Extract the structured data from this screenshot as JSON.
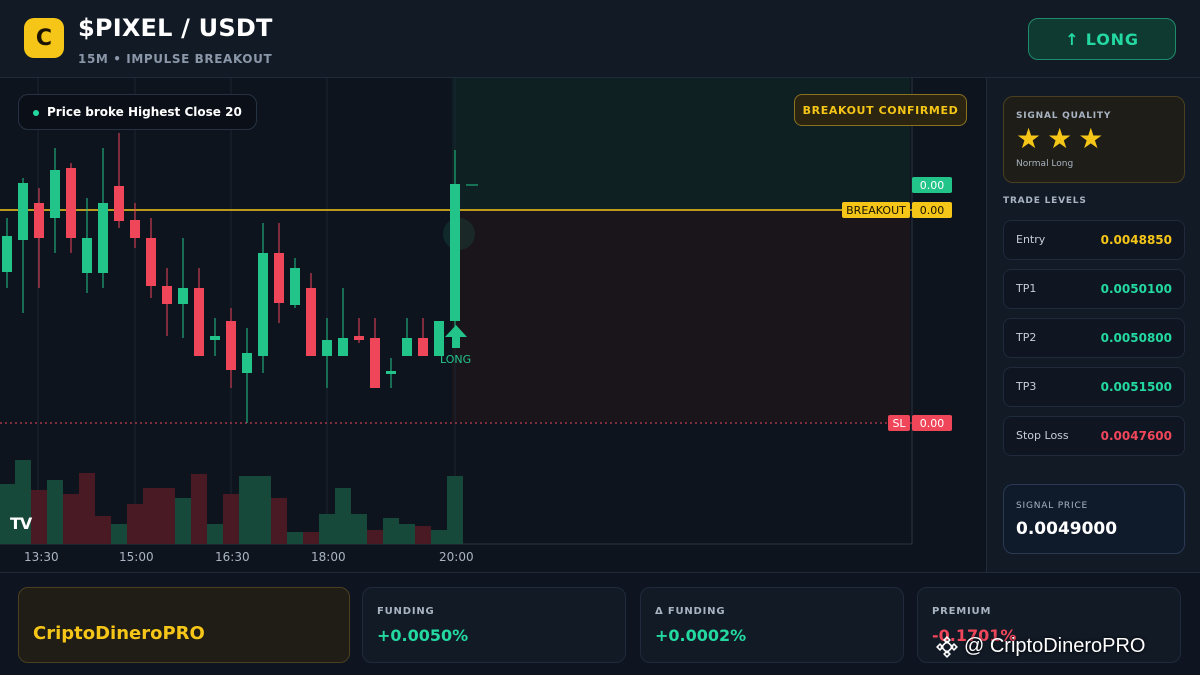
{
  "header": {
    "logo_letter": "C",
    "pair": "$PIXEL / USDT",
    "subtitle": "15M • IMPULSE BREAKOUT",
    "long_button": "↑ LONG"
  },
  "chart": {
    "info_pill": "Price broke Highest Close 20",
    "breakout_badge": "BREAKOUT CONFIRMED",
    "tag_top": "0.00",
    "breakout_label": "BREAKOUT",
    "breakout_value": "0.00",
    "sl_label": "SL",
    "sl_value": "0.00",
    "long_marker": "LONG",
    "tv_logo": "TV",
    "time_labels": [
      "13:30",
      "15:00",
      "16:30",
      "18:00",
      "20:00"
    ],
    "colors": {
      "up": "#23c48a",
      "down": "#f0465a",
      "breakout": "#f5c518"
    }
  },
  "panel": {
    "signal_quality_title": "SIGNAL QUALITY",
    "stars": 3,
    "signal_quality_sub": "Normal Long",
    "trade_levels_title": "TRADE LEVELS",
    "levels": [
      {
        "name": "Entry",
        "value": "0.0048850",
        "color": "#f5c518"
      },
      {
        "name": "TP1",
        "value": "0.0050100",
        "color": "#23d9a0"
      },
      {
        "name": "TP2",
        "value": "0.0050800",
        "color": "#23d9a0"
      },
      {
        "name": "TP3",
        "value": "0.0051500",
        "color": "#23d9a0"
      },
      {
        "name": "Stop Loss",
        "value": "0.0047600",
        "color": "#f0465a"
      }
    ],
    "signal_price_title": "SIGNAL PRICE",
    "signal_price": "0.0049000"
  },
  "footer": {
    "brand": "CriptoDineroPRO",
    "stats": [
      {
        "label": "FUNDING",
        "value": "+0.0050%",
        "color": "#23d9a0"
      },
      {
        "label": "Δ FUNDING",
        "value": "+0.0002%",
        "color": "#23d9a0"
      },
      {
        "label": "PREMIUM",
        "value": "-0.1701%",
        "color": "#f0465a"
      }
    ],
    "watermark": "@ CriptoDineroPRO"
  }
}
